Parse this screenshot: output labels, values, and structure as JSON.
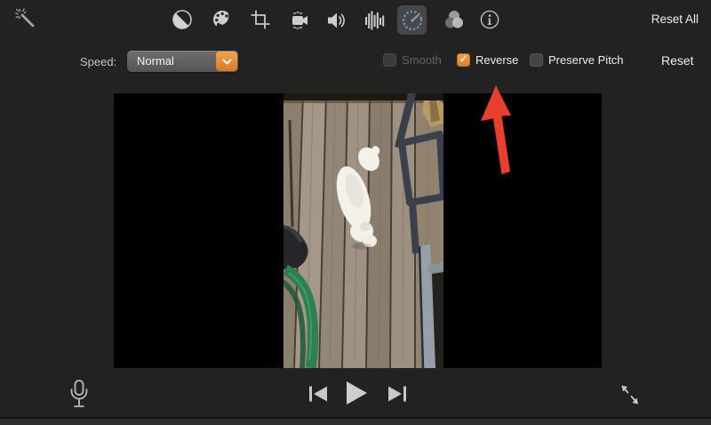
{
  "colors": {
    "accent_orange": "#e0843a",
    "arrow_red": "#e8402d",
    "speed_icon_blue": "#7d9fc7",
    "selected_icon_bg": "#47474a",
    "background": "#222222",
    "viewer_black": "#000000"
  },
  "toolbar": {
    "reset_all_label": "Reset All",
    "icons": [
      {
        "name": "enhance-magic-wand-icon",
        "selected": false
      },
      {
        "name": "color-balance-icon",
        "selected": false
      },
      {
        "name": "color-correction-icon",
        "selected": false
      },
      {
        "name": "cropping-icon",
        "selected": false
      },
      {
        "name": "stabilization-icon",
        "selected": false
      },
      {
        "name": "volume-icon",
        "selected": false
      },
      {
        "name": "noise-reduction-eq-icon",
        "selected": false
      },
      {
        "name": "speed-icon",
        "selected": true
      },
      {
        "name": "clip-filters-icon",
        "selected": false
      },
      {
        "name": "clip-info-icon",
        "selected": false
      }
    ]
  },
  "speed_panel": {
    "label": "Speed:",
    "dropdown_value": "Normal",
    "checkmark": "✓",
    "checkboxes": [
      {
        "label": "Smooth",
        "checked": false,
        "disabled": true
      },
      {
        "label": "Reverse",
        "checked": true,
        "disabled": false
      },
      {
        "label": "Preserve Pitch",
        "checked": false,
        "disabled": false
      }
    ],
    "reset_label": "Reset"
  },
  "viewer": {
    "annotation": "red-arrow-pointing-to-reverse-checkbox",
    "video_content": "portrait clip of white puppy on wooden deck with metal frame and green hose reel"
  },
  "transport": {
    "icons": [
      "voiceover-mic-icon",
      "previous-frame-icon",
      "play-icon",
      "next-frame-icon",
      "fullscreen-icon"
    ]
  }
}
